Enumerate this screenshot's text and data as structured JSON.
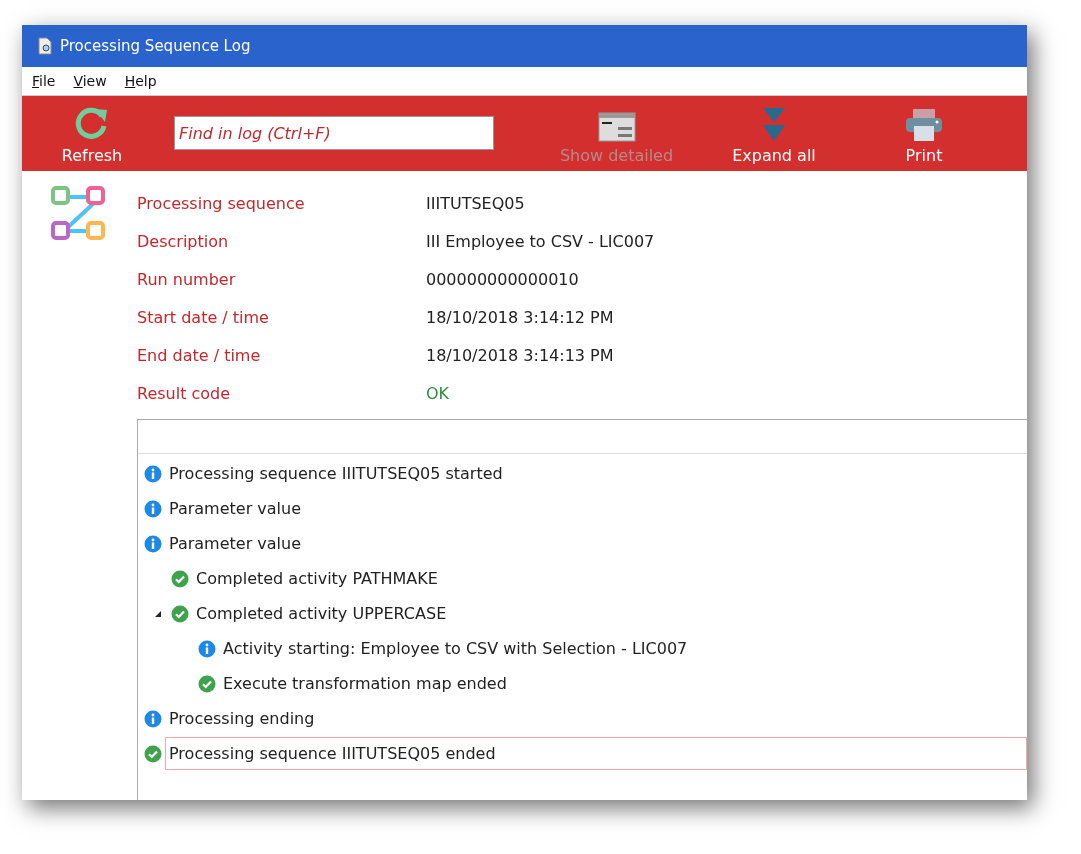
{
  "window": {
    "title": "Processing Sequence Log"
  },
  "menu": [
    {
      "label": "File"
    },
    {
      "label": "View"
    },
    {
      "label": "Help"
    }
  ],
  "toolbar": {
    "buttons": [
      {
        "kind": "refresh",
        "label": "Refresh",
        "disabled": false
      }
    ],
    "search": {
      "placeholder": "Find in log (Ctrl+F)"
    },
    "actions": [
      {
        "kind": "detail",
        "label": "Show detailed",
        "disabled": true
      },
      {
        "kind": "expand",
        "label": "Expand all",
        "disabled": false
      },
      {
        "kind": "print",
        "label": "Print",
        "disabled": false
      }
    ]
  },
  "details": [
    {
      "label": "Processing sequence",
      "value": "IIITUTSEQ05",
      "kind": "plain"
    },
    {
      "label": "Description",
      "value": "III Employee to CSV - LIC007",
      "kind": "plain"
    },
    {
      "label": "Run number",
      "value": "000000000000010",
      "kind": "plain"
    },
    {
      "label": "Start date / time",
      "value": "18/10/2018 3:14:12 PM",
      "kind": "plain"
    },
    {
      "label": "End date / time",
      "value": "18/10/2018 3:14:13 PM",
      "kind": "plain"
    },
    {
      "label": "Result code",
      "value": "OK",
      "kind": "ok"
    }
  ],
  "log": [
    {
      "kind": "info",
      "text": "Processing sequence IIITUTSEQ05 started",
      "selected": false
    },
    {
      "kind": "info",
      "text": "Parameter value",
      "selected": false
    },
    {
      "kind": "info",
      "text": "Parameter value",
      "selected": false,
      "children": [
        {
          "kind": "success",
          "text": "Completed activity PATHMAKE",
          "selected": false
        },
        {
          "kind": "success",
          "text": "Completed activity UPPERCASE",
          "selected": false,
          "expanded": true,
          "children": [
            {
              "kind": "info",
              "text": "Activity starting: Employee to CSV with Selection - LIC007",
              "selected": false
            },
            {
              "kind": "success",
              "text": "Execute transformation map ended",
              "selected": false
            }
          ]
        }
      ]
    },
    {
      "kind": "info",
      "text": "Processing ending",
      "selected": false
    },
    {
      "kind": "success",
      "text": "Processing sequence IIITUTSEQ05 ended",
      "selected": true
    }
  ]
}
